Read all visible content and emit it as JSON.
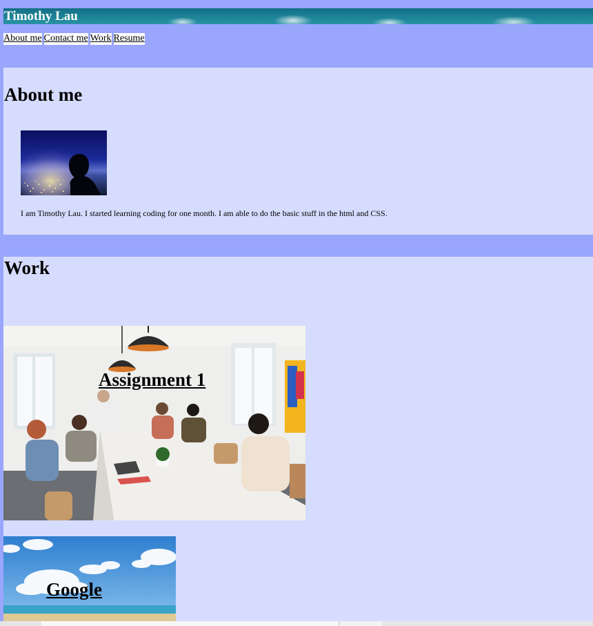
{
  "header": {
    "title": "Timothy Lau"
  },
  "nav": {
    "items": [
      "About me",
      "Contact me",
      "Work",
      "Resume"
    ]
  },
  "about": {
    "heading": "About me",
    "photo_icon": "profile-photo-silhouette-city-night",
    "text": "I am Timothy Lau. I started learning coding for one month. I am able to do the basic stuff in the html and CSS."
  },
  "work": {
    "heading": "Work",
    "projects": [
      {
        "label": "Assignment 1",
        "image": "office-meeting-room-photo"
      },
      {
        "label": "Google",
        "image": "beach-sky-clouds-photo"
      }
    ]
  },
  "colors": {
    "page_background": "#99a6fb",
    "section_background": "#d6dcfd",
    "banner": "#1d8396",
    "title_text": "#ffffff"
  }
}
